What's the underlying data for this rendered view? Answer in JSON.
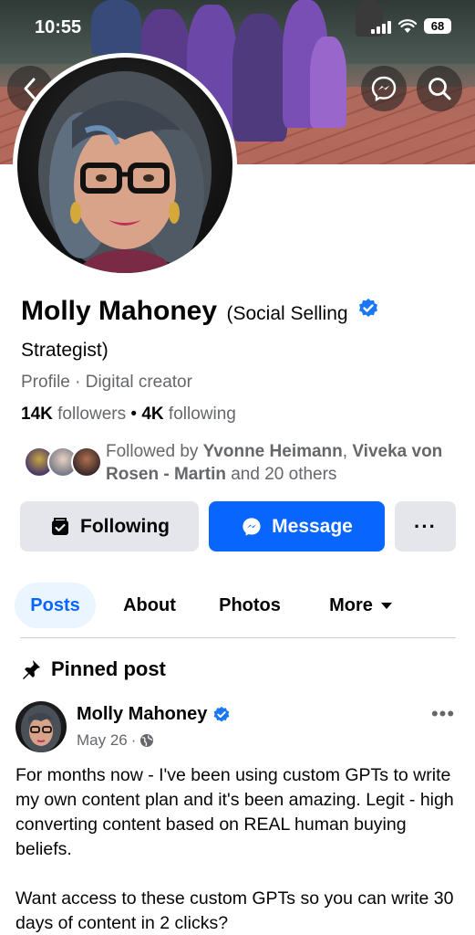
{
  "status_bar": {
    "time": "10:55",
    "battery": "68"
  },
  "nav": {
    "back_icon": "chevron-left-icon",
    "messenger_icon": "messenger-icon",
    "search_icon": "search-icon"
  },
  "profile": {
    "name": "Molly Mahoney",
    "name_suffix": "(Social Selling",
    "name_suffix_2": "Strategist)",
    "category": "Profile · Digital creator",
    "followers_count": "14K",
    "followers_label": "followers",
    "separator": " • ",
    "following_count": "4K",
    "following_label": "following",
    "mutual_prefix": "Followed by ",
    "mutual_name_1": "Yvonne Heimann",
    "mutual_comma": ", ",
    "mutual_name_2": "Viveka von Rosen - Martin",
    "mutual_suffix": " and 20 others"
  },
  "actions": {
    "following_label": "Following",
    "message_label": "Message",
    "more_label": "···"
  },
  "tabs": [
    {
      "label": "Posts",
      "active": true
    },
    {
      "label": "About",
      "active": false
    },
    {
      "label": "Photos",
      "active": false
    },
    {
      "label": "More",
      "active": false
    }
  ],
  "pinned": {
    "label": "Pinned post",
    "author": "Molly Mahoney",
    "date": "May 26",
    "date_separator": "·",
    "menu": "•••",
    "paragraph_1": "For months now - I've been using custom GPTs to write my own content plan and it's been amazing. Legit - high converting content based on REAL human buying beliefs.",
    "paragraph_2": "Want access to these custom GPTs so you can write 30 days of content in 2 clicks?"
  },
  "colors": {
    "accent": "#0866ff",
    "verified": "#1877f2",
    "muted": "#65676b",
    "tab_bg": "#ebf5ff"
  }
}
